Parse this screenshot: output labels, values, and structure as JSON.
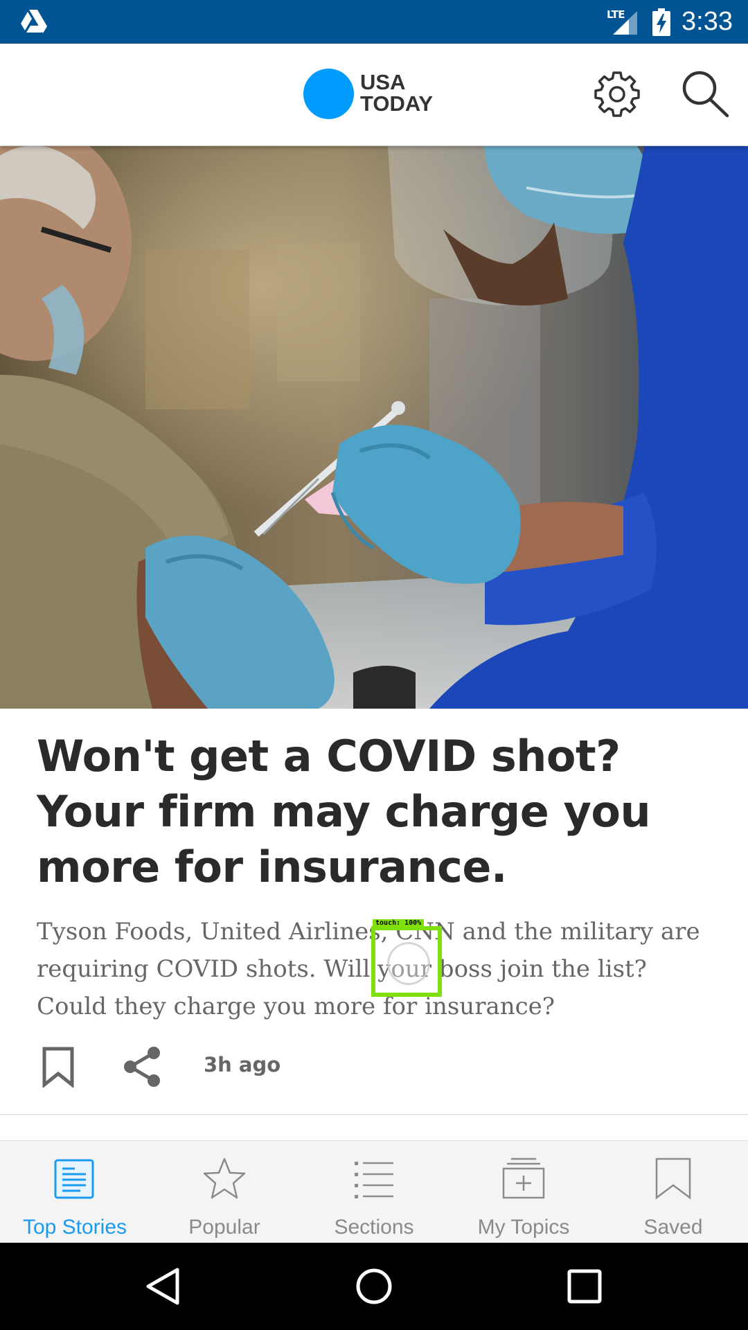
{
  "status_bar": {
    "app_icon": "drive-icon",
    "network": "LTE",
    "time": "3:33",
    "background_color": "#005493"
  },
  "header": {
    "logo": {
      "line1": "USA",
      "line2": "TODAY",
      "dot_color": "#009bff"
    },
    "settings_icon": "gear-icon",
    "search_icon": "search-icon"
  },
  "article": {
    "image_alt": "vaccine-injection-photo",
    "headline": "Won't get a COVID shot? Your firm may charge you more for insurance.",
    "summary": "Tyson Foods, United Airlines, CNN and the military are requiring COVID shots. Will your boss join the list? Could they charge you more for insurance?",
    "timestamp": "3h ago",
    "bookmark_icon": "bookmark-icon",
    "share_icon": "share-icon"
  },
  "touch_indicator": {
    "label": "touch: 100%",
    "color": "#7fe00e"
  },
  "bottom_nav": {
    "active_color": "#1a9bf0",
    "inactive_color": "#8a8a8a",
    "items": [
      {
        "label": "Top Stories",
        "icon": "top-stories-icon",
        "active": true
      },
      {
        "label": "Popular",
        "icon": "star-icon",
        "active": false
      },
      {
        "label": "Sections",
        "icon": "list-icon",
        "active": false
      },
      {
        "label": "My Topics",
        "icon": "my-topics-icon",
        "active": false
      },
      {
        "label": "Saved",
        "icon": "bookmark-icon",
        "active": false
      }
    ]
  },
  "system_nav": {
    "back_icon": "back-triangle-icon",
    "home_icon": "home-circle-icon",
    "recents_icon": "recents-square-icon"
  }
}
